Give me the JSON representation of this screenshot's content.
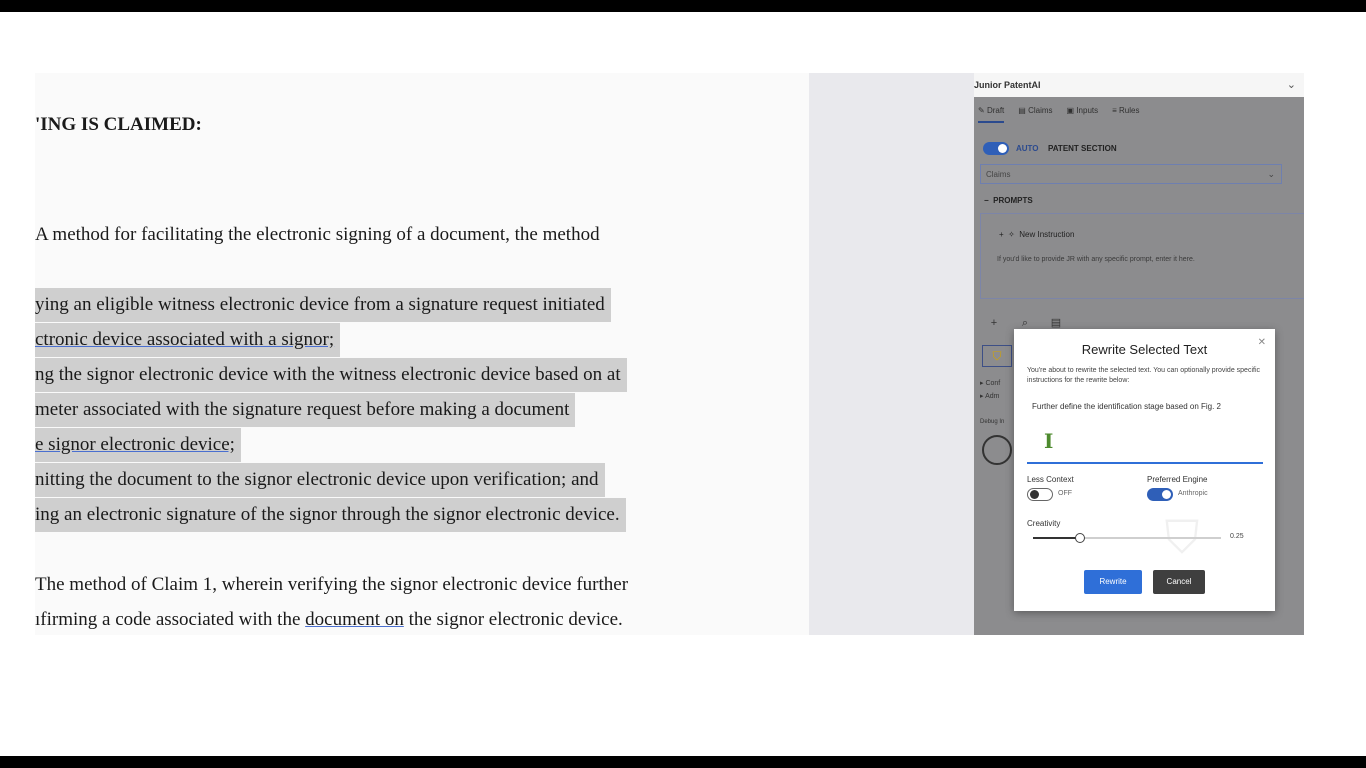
{
  "document": {
    "heading": "'ING IS CLAIMED:",
    "claim1_intro": "A method for facilitating the electronic signing of a document, the method",
    "claim1_lines": [
      "ying an eligible witness electronic device from a signature request initiated",
      "ctronic device associated with a signor;",
      "ng the signor electronic device with the witness electronic device based on at",
      "meter associated with the signature request before making a document",
      "e signor electronic device;",
      "nitting the document to the signor electronic device upon verification; and",
      "ing an electronic signature of the signor through the signor electronic device."
    ],
    "claim2_line1": "The method of Claim 1, wherein verifying the signor electronic device further",
    "claim2_line2_pre": "ıfirming a code associated with the ",
    "claim2_line2_link": "document  on",
    "claim2_line2_post": " the signor electronic device."
  },
  "panel": {
    "title": "Junior PatentAI",
    "tabs": [
      "Draft",
      "Claims",
      "Inputs",
      "Rules"
    ],
    "tab_icons": [
      "pencil-icon",
      "document-icon",
      "inbox-icon",
      "list-icon"
    ],
    "auto_label": "AUTO",
    "section_label": "PATENT SECTION",
    "section_value": "Claims",
    "prompts_label": "PROMPTS",
    "new_instruction": "New Instruction",
    "new_instruction_hint": "If you'd like to provide JR with any specific prompt, enter it here.",
    "conf_items": [
      "Conf",
      "Adm"
    ],
    "debug_label": "Debug In"
  },
  "dialog": {
    "title": "Rewrite Selected Text",
    "description": "You're about to rewrite the selected text. You can optionally provide specific instructions for the rewrite below:",
    "input_value": "Further define the identification stage based on Fig. 2",
    "less_context_label": "Less Context",
    "less_context_value": "OFF",
    "less_context_on": false,
    "engine_label": "Preferred Engine",
    "engine_value": "Anthropic",
    "engine_on": true,
    "creativity_label": "Creativity",
    "creativity_value": "0.25",
    "creativity": 0.25,
    "rewrite_label": "Rewrite",
    "cancel_label": "Cancel"
  },
  "colors": {
    "accent": "#2f6fd8",
    "highlight": "#cfcfcf",
    "panel_bg": "#8c8c8e"
  }
}
